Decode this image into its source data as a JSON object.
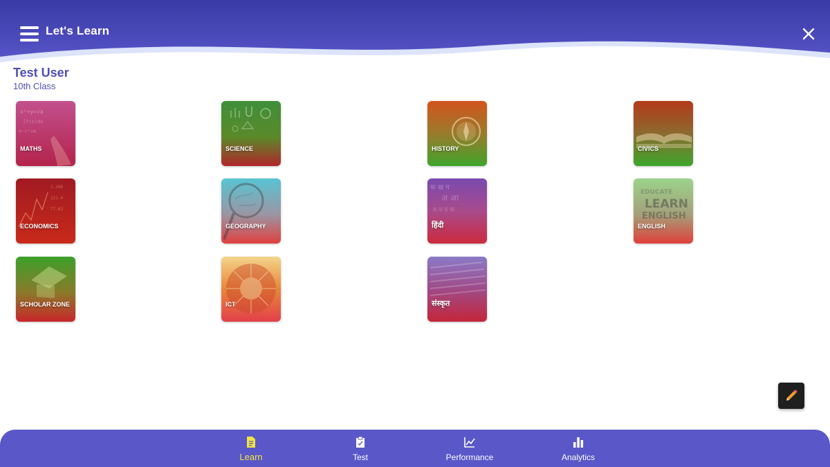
{
  "header": {
    "title": "Let's Learn",
    "menu_icon": "hamburger-menu-icon",
    "close_icon": "close-icon"
  },
  "user": {
    "name": "Test User",
    "class": "10th  Class"
  },
  "subjects": [
    {
      "label": "MATHS"
    },
    {
      "label": "SCIENCE"
    },
    {
      "label": "HISTORY"
    },
    {
      "label": "CIVICS"
    },
    {
      "label": "ECONOMICS"
    },
    {
      "label": "GEOGRAPHY"
    },
    {
      "label": "हिंदी"
    },
    {
      "label": "ENGLISH"
    },
    {
      "label": "SCHOLAR ZONE"
    },
    {
      "label": "ICT"
    },
    {
      "label": "संस्कृत"
    }
  ],
  "fab": {
    "icon": "pencil-icon"
  },
  "bottom_nav": {
    "active": "Learn",
    "items": [
      {
        "label": "Learn",
        "icon": "document-icon"
      },
      {
        "label": "Test",
        "icon": "clipboard-icon"
      },
      {
        "label": "Performance",
        "icon": "line-chart-icon"
      },
      {
        "label": "Analytics",
        "icon": "bar-chart-icon"
      }
    ]
  },
  "colors": {
    "brand": "#4f4fb0",
    "nav_bg": "#5a57c8",
    "active_tab": "#f1e443"
  }
}
